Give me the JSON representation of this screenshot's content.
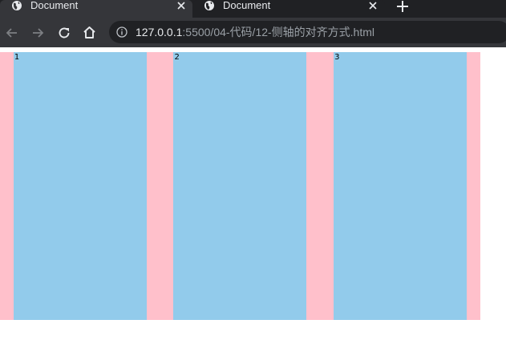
{
  "browser": {
    "tabs": [
      {
        "title": "Document",
        "active": true
      },
      {
        "title": "Document",
        "active": false
      }
    ],
    "new_tab_icon": "plus-icon",
    "nav_icons": [
      "back-arrow-icon",
      "forward-arrow-icon",
      "reload-icon",
      "home-icon"
    ],
    "address": {
      "info_icon": "info-icon",
      "host": "127.0.0.1",
      "rest": ":5500/04-代码/12-侧轴的对齐方式.html"
    }
  },
  "page": {
    "container_color": "#ffc0cb",
    "item_color": "#92cbeb",
    "items": [
      "1",
      "2",
      "3"
    ]
  }
}
